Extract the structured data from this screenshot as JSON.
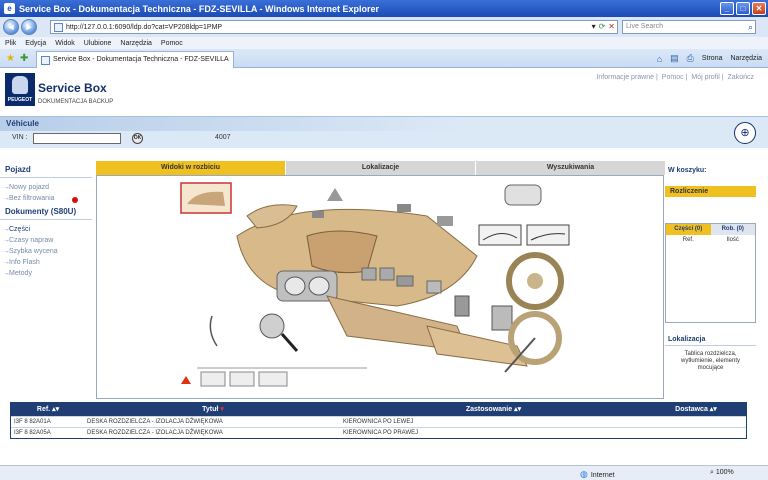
{
  "window": {
    "title": "Service Box - Dokumentacja Techniczna - FDZ-SEVILLA - Windows Internet Explorer",
    "url": "http://127.0.0.1:6090/ldp.do?cat=VP208ldp=1PMP",
    "search_placeholder": "Live Search",
    "tab_title": "Service Box - Dokumentacja Techniczna - FDZ-SEVILLA",
    "menu": [
      "Plik",
      "Edycja",
      "Widok",
      "Ulubione",
      "Narzędzia",
      "Pomoc"
    ],
    "tools": {
      "strona": "Strona",
      "narzedzia": "Narzędzia"
    }
  },
  "header": {
    "logo_text": "PEUGEOT",
    "title": "Service Box",
    "subtitle": "DOKUMENTACJA BACKUP",
    "links": [
      "Informacje prawne",
      "Pomoc",
      "Mój profil",
      "Zakończ"
    ]
  },
  "vehicle": {
    "heading": "Véhicule",
    "vin_label": "VIN :",
    "vin_value": "",
    "ok_label": "OK",
    "code": "4007"
  },
  "leftnav": {
    "pojazd_head": "Pojazd",
    "pojazd_items": [
      "Nowy pojazd",
      "Bez filtrowania"
    ],
    "docs_head": "Dokumenty (S80U)",
    "doc_items": [
      "Części",
      "Czasy napraw",
      "Szybka wycena",
      "Info Flash",
      "Metody"
    ]
  },
  "main": {
    "tabs": [
      "Widoki w rozbiciu",
      "Lokalizacje",
      "Wyszukiwania"
    ],
    "active_tab": 0
  },
  "right": {
    "basket_head": "W koszyku:",
    "rozliczenie": "Rozliczenie",
    "cart_tabs": [
      "Części (0)",
      "Rob. (0)"
    ],
    "cart_cols": [
      "Ref.",
      "Ilość"
    ],
    "lok_head": "Lokalizacja",
    "lok_text": "Tablica rozdzielcza, wytłumienie, elementy mocujące"
  },
  "results": {
    "columns": [
      "Ref.",
      "Tytuł",
      "Zastosowanie",
      "Dostawca"
    ],
    "rows": [
      [
        "I3F 8 82A01A",
        "DESKA ROZDZIELCZA - IZOLACJA DŹWIĘKOWA",
        "KIEROWNICA PO LEWEJ",
        ""
      ],
      [
        "I3F 8 82A05A",
        "DESKA ROZDZIELCZA - IZOLACJA DŹWIĘKOWA",
        "KIEROWNICA PO PRAWEJ",
        ""
      ]
    ]
  },
  "status": {
    "zone": "Internet",
    "zoom": "100%"
  },
  "colors": {
    "accent_yellow": "#f0c020",
    "navy": "#1f3e74",
    "ie_blue": "#1b4bb4"
  }
}
